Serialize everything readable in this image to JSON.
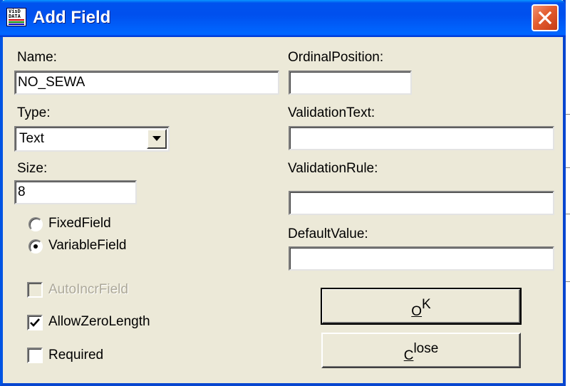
{
  "window": {
    "title": "Add Field",
    "icon": "visdata-icon",
    "accent": "#0054e3",
    "close_color": "#e35d2f"
  },
  "left": {
    "name_label": "Name:",
    "name_value": "NO_SEWA",
    "type_label": "Type:",
    "type_value": "Text",
    "size_label": "Size:",
    "size_value": "8",
    "fixed_label": "FixedField",
    "variable_label": "VariableField",
    "selected_field_kind": "VariableField",
    "autoincr_label": "AutoIncrField",
    "autoincr_checked": false,
    "autoincr_enabled": false,
    "allowzero_label": "AllowZeroLength",
    "allowzero_checked": true,
    "required_label": "Required",
    "required_checked": false
  },
  "right": {
    "ordinal_label": "OrdinalPosition:",
    "ordinal_value": "",
    "validationtext_label": "ValidationText:",
    "validationtext_value": "",
    "validationrule_label": "ValidationRule:",
    "validationrule_value": "",
    "defaultvalue_label": "DefaultValue:",
    "defaultvalue_value": ""
  },
  "buttons": {
    "ok_mnemonic": "O",
    "ok_rest": "K",
    "close_mnemonic": "C",
    "close_rest": "lose"
  }
}
